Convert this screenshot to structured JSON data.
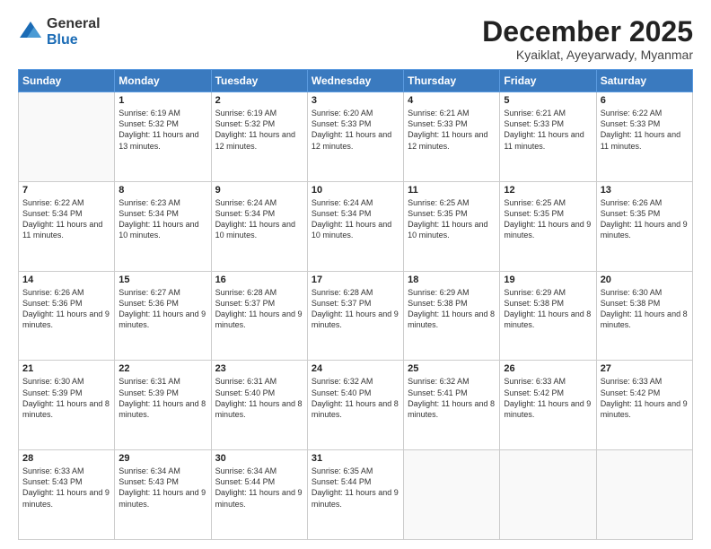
{
  "logo": {
    "general": "General",
    "blue": "Blue"
  },
  "header": {
    "title": "December 2025",
    "subtitle": "Kyaiklat, Ayeyarwady, Myanmar"
  },
  "weekdays": [
    "Sunday",
    "Monday",
    "Tuesday",
    "Wednesday",
    "Thursday",
    "Friday",
    "Saturday"
  ],
  "weeks": [
    [
      {
        "day": "",
        "sunrise": "",
        "sunset": "",
        "daylight": ""
      },
      {
        "day": "1",
        "sunrise": "Sunrise: 6:19 AM",
        "sunset": "Sunset: 5:32 PM",
        "daylight": "Daylight: 11 hours and 13 minutes."
      },
      {
        "day": "2",
        "sunrise": "Sunrise: 6:19 AM",
        "sunset": "Sunset: 5:32 PM",
        "daylight": "Daylight: 11 hours and 12 minutes."
      },
      {
        "day": "3",
        "sunrise": "Sunrise: 6:20 AM",
        "sunset": "Sunset: 5:33 PM",
        "daylight": "Daylight: 11 hours and 12 minutes."
      },
      {
        "day": "4",
        "sunrise": "Sunrise: 6:21 AM",
        "sunset": "Sunset: 5:33 PM",
        "daylight": "Daylight: 11 hours and 12 minutes."
      },
      {
        "day": "5",
        "sunrise": "Sunrise: 6:21 AM",
        "sunset": "Sunset: 5:33 PM",
        "daylight": "Daylight: 11 hours and 11 minutes."
      },
      {
        "day": "6",
        "sunrise": "Sunrise: 6:22 AM",
        "sunset": "Sunset: 5:33 PM",
        "daylight": "Daylight: 11 hours and 11 minutes."
      }
    ],
    [
      {
        "day": "7",
        "sunrise": "Sunrise: 6:22 AM",
        "sunset": "Sunset: 5:34 PM",
        "daylight": "Daylight: 11 hours and 11 minutes."
      },
      {
        "day": "8",
        "sunrise": "Sunrise: 6:23 AM",
        "sunset": "Sunset: 5:34 PM",
        "daylight": "Daylight: 11 hours and 10 minutes."
      },
      {
        "day": "9",
        "sunrise": "Sunrise: 6:24 AM",
        "sunset": "Sunset: 5:34 PM",
        "daylight": "Daylight: 11 hours and 10 minutes."
      },
      {
        "day": "10",
        "sunrise": "Sunrise: 6:24 AM",
        "sunset": "Sunset: 5:34 PM",
        "daylight": "Daylight: 11 hours and 10 minutes."
      },
      {
        "day": "11",
        "sunrise": "Sunrise: 6:25 AM",
        "sunset": "Sunset: 5:35 PM",
        "daylight": "Daylight: 11 hours and 10 minutes."
      },
      {
        "day": "12",
        "sunrise": "Sunrise: 6:25 AM",
        "sunset": "Sunset: 5:35 PM",
        "daylight": "Daylight: 11 hours and 9 minutes."
      },
      {
        "day": "13",
        "sunrise": "Sunrise: 6:26 AM",
        "sunset": "Sunset: 5:35 PM",
        "daylight": "Daylight: 11 hours and 9 minutes."
      }
    ],
    [
      {
        "day": "14",
        "sunrise": "Sunrise: 6:26 AM",
        "sunset": "Sunset: 5:36 PM",
        "daylight": "Daylight: 11 hours and 9 minutes."
      },
      {
        "day": "15",
        "sunrise": "Sunrise: 6:27 AM",
        "sunset": "Sunset: 5:36 PM",
        "daylight": "Daylight: 11 hours and 9 minutes."
      },
      {
        "day": "16",
        "sunrise": "Sunrise: 6:28 AM",
        "sunset": "Sunset: 5:37 PM",
        "daylight": "Daylight: 11 hours and 9 minutes."
      },
      {
        "day": "17",
        "sunrise": "Sunrise: 6:28 AM",
        "sunset": "Sunset: 5:37 PM",
        "daylight": "Daylight: 11 hours and 9 minutes."
      },
      {
        "day": "18",
        "sunrise": "Sunrise: 6:29 AM",
        "sunset": "Sunset: 5:38 PM",
        "daylight": "Daylight: 11 hours and 8 minutes."
      },
      {
        "day": "19",
        "sunrise": "Sunrise: 6:29 AM",
        "sunset": "Sunset: 5:38 PM",
        "daylight": "Daylight: 11 hours and 8 minutes."
      },
      {
        "day": "20",
        "sunrise": "Sunrise: 6:30 AM",
        "sunset": "Sunset: 5:38 PM",
        "daylight": "Daylight: 11 hours and 8 minutes."
      }
    ],
    [
      {
        "day": "21",
        "sunrise": "Sunrise: 6:30 AM",
        "sunset": "Sunset: 5:39 PM",
        "daylight": "Daylight: 11 hours and 8 minutes."
      },
      {
        "day": "22",
        "sunrise": "Sunrise: 6:31 AM",
        "sunset": "Sunset: 5:39 PM",
        "daylight": "Daylight: 11 hours and 8 minutes."
      },
      {
        "day": "23",
        "sunrise": "Sunrise: 6:31 AM",
        "sunset": "Sunset: 5:40 PM",
        "daylight": "Daylight: 11 hours and 8 minutes."
      },
      {
        "day": "24",
        "sunrise": "Sunrise: 6:32 AM",
        "sunset": "Sunset: 5:40 PM",
        "daylight": "Daylight: 11 hours and 8 minutes."
      },
      {
        "day": "25",
        "sunrise": "Sunrise: 6:32 AM",
        "sunset": "Sunset: 5:41 PM",
        "daylight": "Daylight: 11 hours and 8 minutes."
      },
      {
        "day": "26",
        "sunrise": "Sunrise: 6:33 AM",
        "sunset": "Sunset: 5:42 PM",
        "daylight": "Daylight: 11 hours and 9 minutes."
      },
      {
        "day": "27",
        "sunrise": "Sunrise: 6:33 AM",
        "sunset": "Sunset: 5:42 PM",
        "daylight": "Daylight: 11 hours and 9 minutes."
      }
    ],
    [
      {
        "day": "28",
        "sunrise": "Sunrise: 6:33 AM",
        "sunset": "Sunset: 5:43 PM",
        "daylight": "Daylight: 11 hours and 9 minutes."
      },
      {
        "day": "29",
        "sunrise": "Sunrise: 6:34 AM",
        "sunset": "Sunset: 5:43 PM",
        "daylight": "Daylight: 11 hours and 9 minutes."
      },
      {
        "day": "30",
        "sunrise": "Sunrise: 6:34 AM",
        "sunset": "Sunset: 5:44 PM",
        "daylight": "Daylight: 11 hours and 9 minutes."
      },
      {
        "day": "31",
        "sunrise": "Sunrise: 6:35 AM",
        "sunset": "Sunset: 5:44 PM",
        "daylight": "Daylight: 11 hours and 9 minutes."
      },
      {
        "day": "",
        "sunrise": "",
        "sunset": "",
        "daylight": ""
      },
      {
        "day": "",
        "sunrise": "",
        "sunset": "",
        "daylight": ""
      },
      {
        "day": "",
        "sunrise": "",
        "sunset": "",
        "daylight": ""
      }
    ]
  ]
}
